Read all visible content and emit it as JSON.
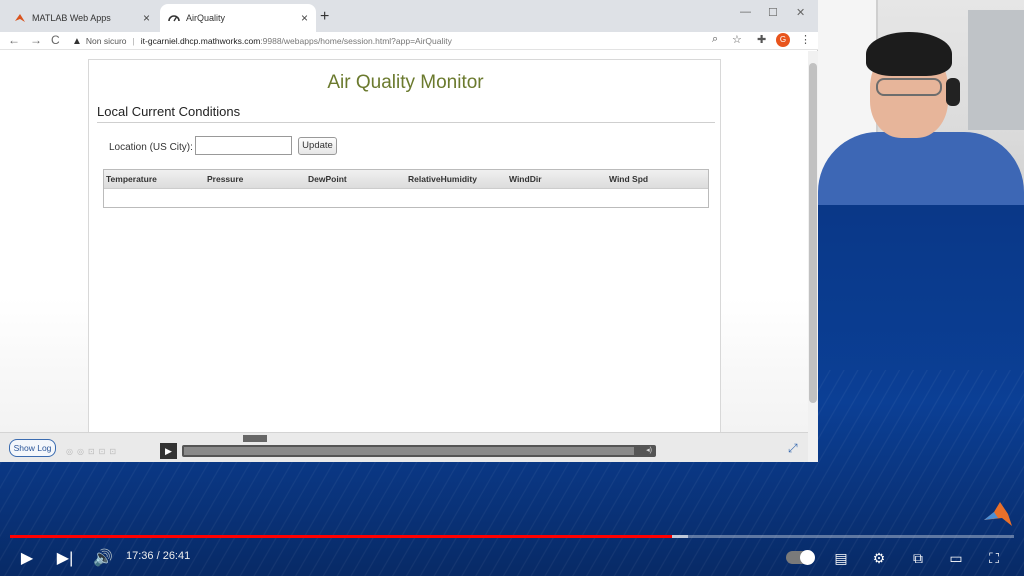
{
  "browser": {
    "tabs": [
      {
        "title": "MATLAB Web Apps",
        "active": false,
        "icon": "matlab-icon"
      },
      {
        "title": "AirQuality",
        "active": true,
        "icon": "gauge-icon"
      }
    ],
    "new_tab": "+",
    "address": {
      "security_label": "Non sicuro",
      "host": "it-gcarniel.dhcp.mathworks.com",
      "path": ":9988/webapps/home/session.html?app=AirQuality"
    },
    "profile_initial": "G"
  },
  "app": {
    "title": "Air Quality Monitor",
    "section_title": "Local Current Conditions",
    "location_label": "Location (US City):",
    "location_value": "",
    "update_label": "Update",
    "table_columns": [
      "Temperature",
      "Pressure",
      "DewPoint",
      "RelativeHumidity",
      "WindDir",
      "Wind Spd"
    ],
    "table_rows": []
  },
  "app_toolbar": {
    "show_log_label": "Show Log"
  },
  "youtube": {
    "current_time": "17:36",
    "duration": "26:41",
    "time_display": "17:36 / 26:41",
    "progress_fraction": 0.659,
    "buffered_fraction": 0.675
  },
  "colors": {
    "app_title": "#6b7a2e",
    "youtube_played": "#ff0000",
    "background_blue": "#0a3a8c"
  }
}
